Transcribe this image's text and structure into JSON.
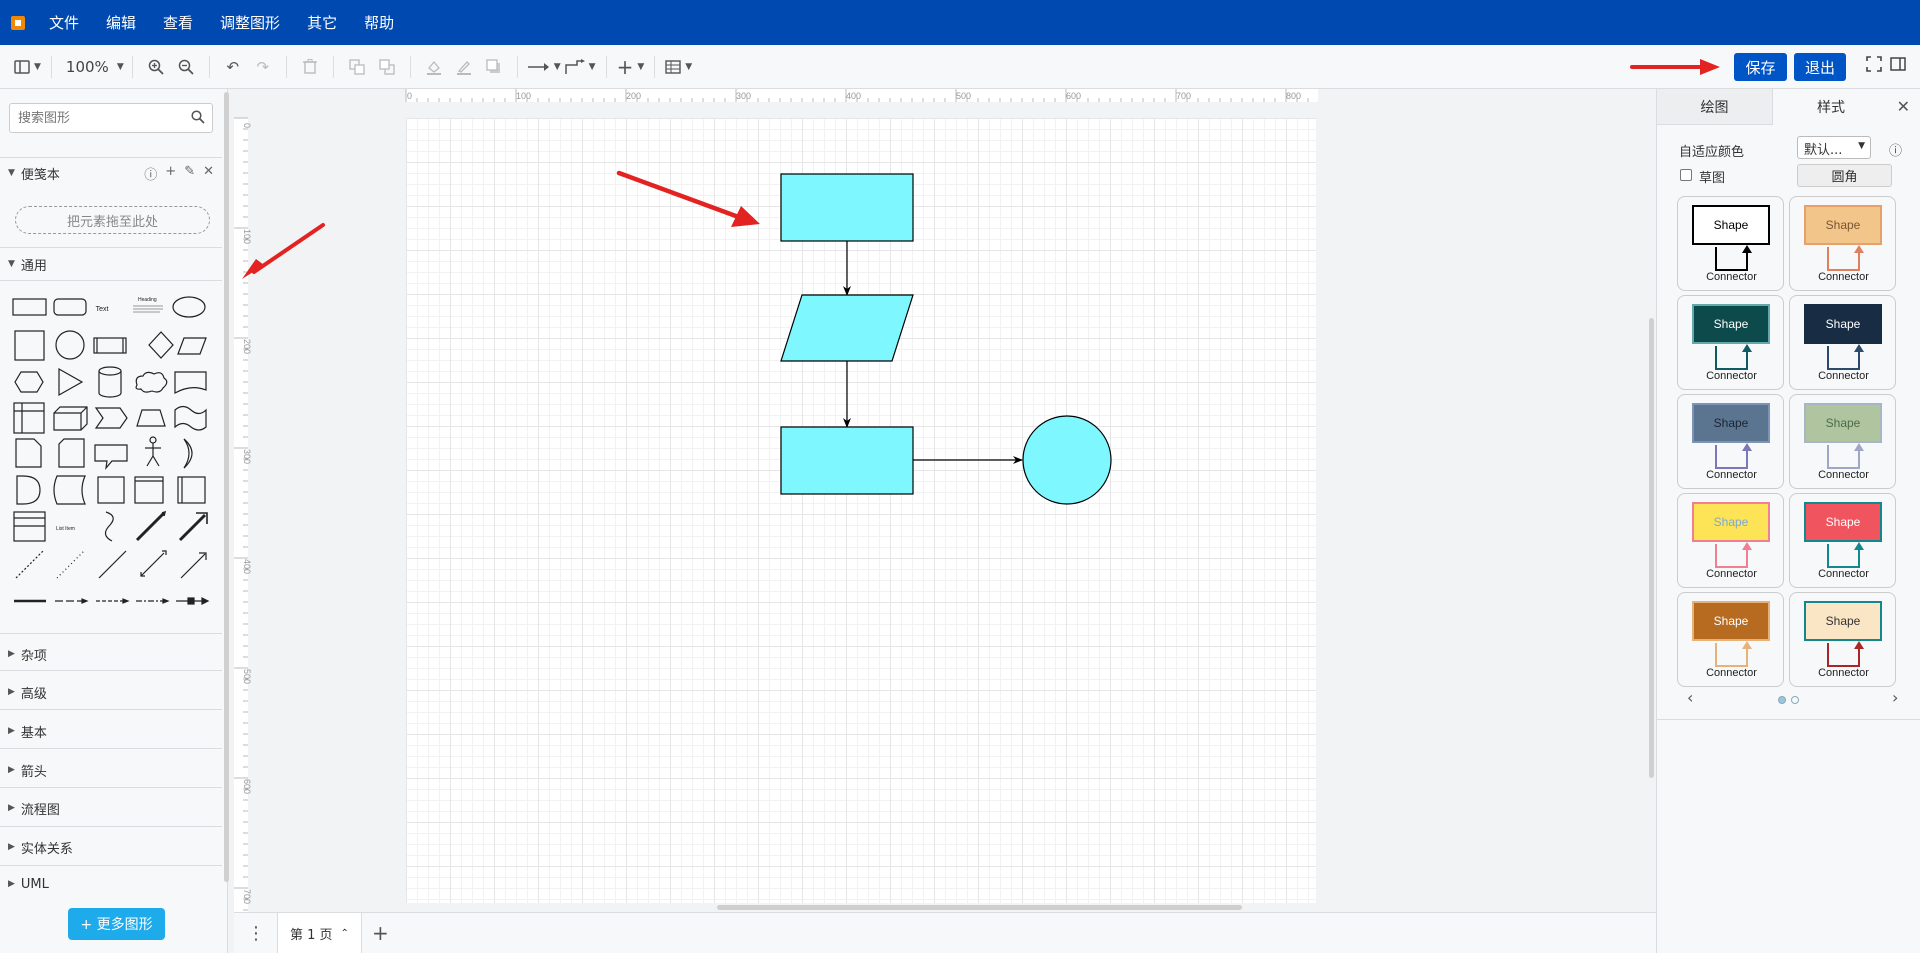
{
  "menubar": {
    "items": [
      "文件",
      "编辑",
      "查看",
      "调整图形",
      "其它",
      "帮助"
    ],
    "bg": "#0049b0"
  },
  "toolbar": {
    "zoom": "100%",
    "save_label": "保存",
    "exit_label": "退出"
  },
  "sidebar": {
    "search_placeholder": "搜索图形",
    "notebook_label": "便笺本",
    "dropzone": "把元素拖至此处",
    "general_label": "通用",
    "text_shape": "Text",
    "heading_shape": "Heading",
    "list_item_shape": "List Item",
    "sections": [
      "杂项",
      "高级",
      "基本",
      "箭头",
      "流程图",
      "实体关系",
      "UML"
    ],
    "more_shapes": "+ 更多图形"
  },
  "ruler": {
    "top": [
      "0",
      "100",
      "200",
      "300",
      "400",
      "500",
      "600",
      "700",
      "800"
    ],
    "left": [
      "0",
      "100",
      "200",
      "300",
      "400",
      "500",
      "600",
      "700"
    ]
  },
  "diagram": {
    "fill": "#7ff7ff",
    "nodes": [
      "rect-1",
      "parallelogram",
      "rect-2",
      "circle"
    ]
  },
  "pages": {
    "current": "第 1 页"
  },
  "rpanel": {
    "tab_draw": "绘图",
    "tab_style": "样式",
    "adaptive_color": "自适应颜色",
    "select_value": "默认...",
    "sketch": "草图",
    "rounded": "圆角",
    "styles": [
      {
        "shape": "Shape",
        "connector": "Connector",
        "fill": "#ffffff",
        "stroke": "#000000",
        "text": "#000000",
        "line": "#000000"
      },
      {
        "shape": "Shape",
        "connector": "Connector",
        "fill": "#f2c58a",
        "stroke": "#e6a06b",
        "text": "#7a5630",
        "line": "#e0805c"
      },
      {
        "shape": "Shape",
        "connector": "Connector",
        "fill": "#0c4a4c",
        "stroke": "#64a8ac",
        "text": "#ffffff",
        "line": "#0f5a63"
      },
      {
        "shape": "Shape",
        "connector": "Connector",
        "fill": "#182c43",
        "stroke": "#182c43",
        "text": "#ffffff",
        "line": "#2c4a6a"
      },
      {
        "shape": "Shape",
        "connector": "Connector",
        "fill": "#5b7490",
        "stroke": "#7f94b4",
        "text": "#1b2535",
        "line": "#7c77b8"
      },
      {
        "shape": "Shape",
        "connector": "Connector",
        "fill": "#b0c4a0",
        "stroke": "#a6b6c6",
        "text": "#4d6b4a",
        "line": "#a0a6c6"
      },
      {
        "shape": "Shape",
        "connector": "Connector",
        "fill": "#fde456",
        "stroke": "#f07f91",
        "text": "#7ba8d8",
        "line": "#f07f91"
      },
      {
        "shape": "Shape",
        "connector": "Connector",
        "fill": "#f0545f",
        "stroke": "#13878e",
        "text": "#ffffff",
        "line": "#13878e"
      },
      {
        "shape": "Shape",
        "connector": "Connector",
        "fill": "#b76b21",
        "stroke": "#e6b27a",
        "text": "#ffffff",
        "line": "#e6b27a"
      },
      {
        "shape": "Shape",
        "connector": "Connector",
        "fill": "#fae6c5",
        "stroke": "#13878e",
        "text": "#333333",
        "line": "#a82626"
      }
    ]
  }
}
